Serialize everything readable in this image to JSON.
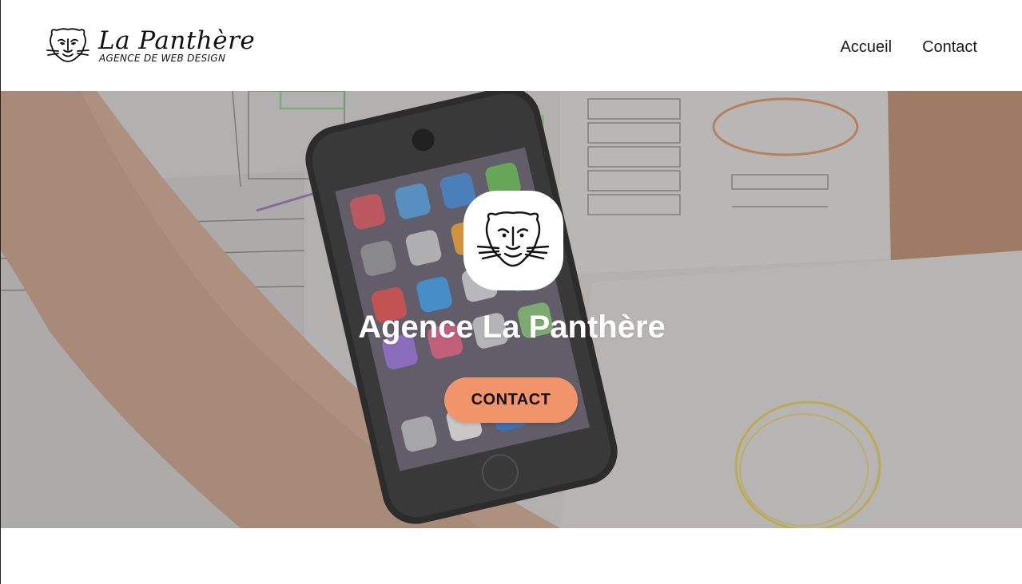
{
  "brand": {
    "name": "La Panthère",
    "tagline": "AGENCE DE WEB DESIGN",
    "logo_icon": "panther-head-icon"
  },
  "nav": {
    "items": [
      {
        "label": "Accueil"
      },
      {
        "label": "Contact"
      }
    ]
  },
  "hero": {
    "background": "desk-with-smartphone-and-wireframe-sketches",
    "emblem_icon": "panther-head-icon",
    "title": "Agence La Panthère",
    "cta_label": "CONTACT"
  },
  "colors": {
    "accent": "#f2946a",
    "text_dark": "#111111",
    "header_bg": "#ffffff",
    "hero_text": "#ffffff"
  }
}
